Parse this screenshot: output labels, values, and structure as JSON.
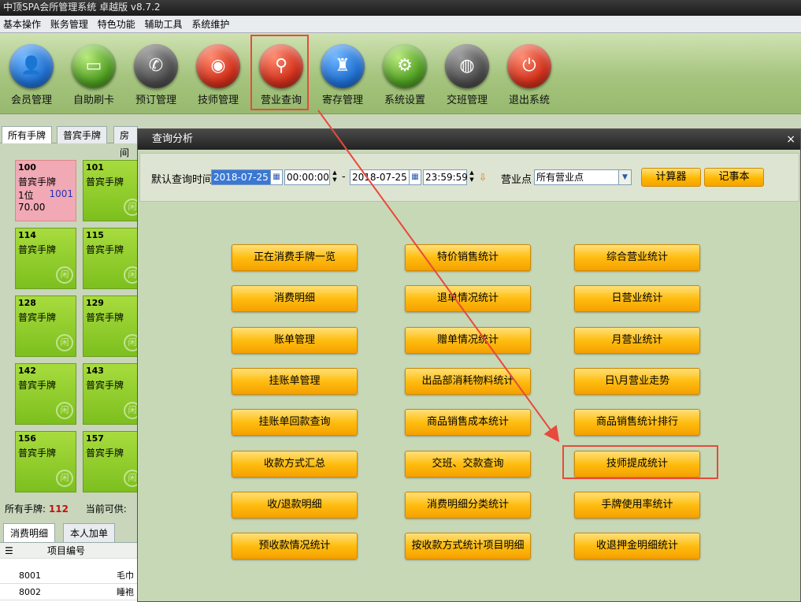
{
  "window_title": "中顶SPA会所管理系统 卓越版 v8.7.2",
  "menu": [
    "基本操作",
    "账务管理",
    "特色功能",
    "辅助工具",
    "系统维护"
  ],
  "toolbar": [
    {
      "label": "会员管理",
      "icon": "user-icon",
      "color": "blue",
      "selected": false
    },
    {
      "label": "自助刷卡",
      "icon": "card-icon",
      "color": "green",
      "selected": false
    },
    {
      "label": "预订管理",
      "icon": "phone-icon",
      "color": "gray",
      "selected": false
    },
    {
      "label": "技师管理",
      "icon": "technician-icon",
      "color": "red",
      "selected": false
    },
    {
      "label": "营业查询",
      "icon": "search-icon",
      "color": "red",
      "selected": true
    },
    {
      "label": "寄存管理",
      "icon": "bag-icon",
      "color": "blue",
      "selected": false
    },
    {
      "label": "系统设置",
      "icon": "gear-icon",
      "color": "green",
      "selected": false
    },
    {
      "label": "交班管理",
      "icon": "shift-icon",
      "color": "gray",
      "selected": false
    },
    {
      "label": "退出系统",
      "icon": "power-icon",
      "color": "red",
      "selected": false
    }
  ],
  "left_tabs": [
    "所有手牌",
    "普宾手牌",
    "房间"
  ],
  "cards": [
    {
      "no": "100",
      "type": "普宾手牌",
      "extra1": "1位",
      "extra2": "1001",
      "extra3": "70.00",
      "occupied": true
    },
    {
      "no": "101",
      "type": "普宾手牌",
      "occupied": false
    },
    {
      "no": "114",
      "type": "普宾手牌",
      "occupied": false
    },
    {
      "no": "115",
      "type": "普宾手牌",
      "occupied": false
    },
    {
      "no": "128",
      "type": "普宾手牌",
      "occupied": false
    },
    {
      "no": "129",
      "type": "普宾手牌",
      "occupied": false
    },
    {
      "no": "142",
      "type": "普宾手牌",
      "occupied": false
    },
    {
      "no": "143",
      "type": "普宾手牌",
      "occupied": false
    },
    {
      "no": "156",
      "type": "普宾手牌",
      "occupied": false
    },
    {
      "no": "157",
      "type": "普宾手牌",
      "occupied": false
    }
  ],
  "count_bar": {
    "all_label": "所有手牌:",
    "all_value": "112",
    "avail_label": "当前可供:"
  },
  "bottom_tabs": [
    "消费明细",
    "本人加单"
  ],
  "grid": {
    "header": "项目编号",
    "rows": [
      {
        "code": "8001",
        "name": "毛巾"
      },
      {
        "code": "8002",
        "name": "睡袍"
      }
    ]
  },
  "dialog": {
    "title": "查询分析",
    "close": "×",
    "time_label": "默认查询时间",
    "start_date": "2018-07-25",
    "start_time": "00:00:00",
    "dash": "-",
    "end_date": "2018-07-25",
    "end_time": "23:59:59",
    "location_label": "营业点",
    "location_value": "所有营业点",
    "calculator": "计算器",
    "notepad": "记事本",
    "buttons": [
      "正在消费手牌一览",
      "特价销售统计",
      "综合营业统计",
      "消费明细",
      "退单情况统计",
      "日营业统计",
      "账单管理",
      "赠单情况统计",
      "月营业统计",
      "挂账单管理",
      "出品部消耗物料统计",
      "日\\月营业走势",
      "挂账单回款查询",
      "商品销售成本统计",
      "商品销售统计排行",
      "收款方式汇总",
      "交班、交款查询",
      "技师提成统计",
      "收/退款明细",
      "消费明细分类统计",
      "手牌使用率统计",
      "预收款情况统计",
      "按收款方式统计项目明细",
      "收退押金明细统计"
    ]
  },
  "colors": {
    "highlight": "#e84a3b",
    "button": "#ffbd10",
    "card": "#8cc82a",
    "card_occupied": "#f0a9b5"
  }
}
